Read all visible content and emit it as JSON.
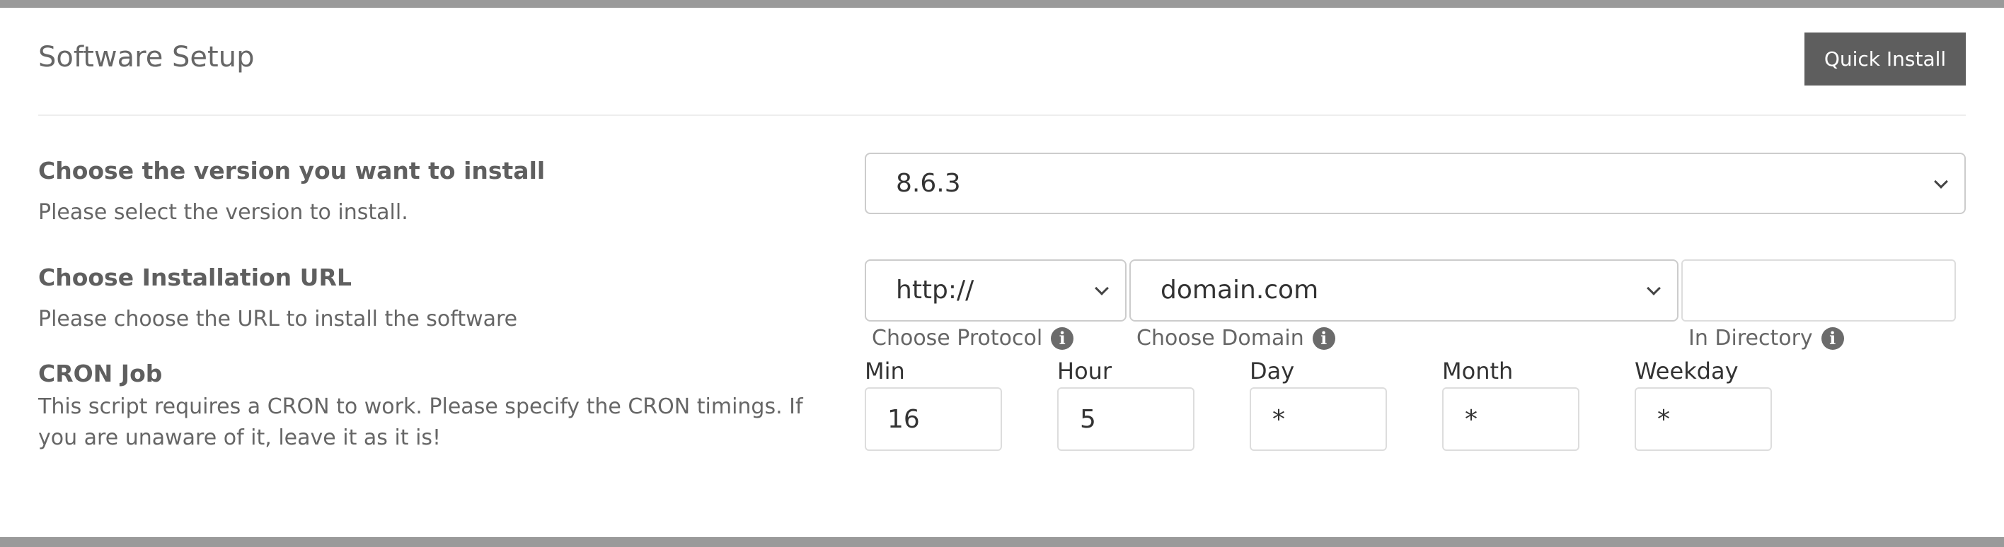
{
  "header": {
    "title": "Software Setup",
    "quick_install_label": "Quick Install"
  },
  "version": {
    "label": "Choose the version you want to install",
    "description": "Please select the version to install.",
    "selected": "8.6.3"
  },
  "install_url": {
    "label": "Choose Installation URL",
    "description": "Please choose the URL to install the software",
    "protocol": {
      "selected": "http://",
      "caption": "Choose Protocol"
    },
    "domain": {
      "selected": "domain.com",
      "caption": "Choose Domain"
    },
    "directory": {
      "value": "",
      "caption": "In Directory"
    }
  },
  "cron": {
    "label": "CRON Job",
    "description_line1": "This script requires a CRON to work. Please specify the CRON timings. If",
    "description_line2": "you are unaware of it, leave it as it is!",
    "fields": [
      {
        "label": "Min",
        "value": "16"
      },
      {
        "label": "Hour",
        "value": "5"
      },
      {
        "label": "Day",
        "value": "*"
      },
      {
        "label": "Month",
        "value": "*"
      },
      {
        "label": "Weekday",
        "value": "*"
      }
    ]
  },
  "icons": {
    "info": "info-icon",
    "dropdown": "chevron-down-icon"
  },
  "colors": {
    "button_bg": "#5e5e5e",
    "border_bar": "#9a9a9a"
  }
}
